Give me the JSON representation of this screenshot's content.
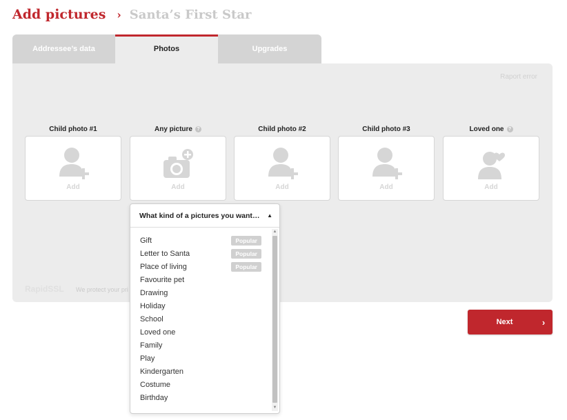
{
  "header": {
    "title": "Add pictures",
    "separator": "›",
    "breadcrumb": "Santa’s First Star"
  },
  "tabs": [
    {
      "label": "Addressee’s data"
    },
    {
      "label": "Photos"
    },
    {
      "label": "Upgrades"
    }
  ],
  "panel": {
    "report_error": "Raport error",
    "rapidssl": "RapidSSL",
    "protect_text": "We protect your pri"
  },
  "slots": [
    {
      "label": "Child photo #1",
      "add": "Add",
      "icon": "child-add-icon",
      "help": false
    },
    {
      "label": "Any picture",
      "add": "Add",
      "icon": "camera-add-icon",
      "help": true
    },
    {
      "label": "Child photo #2",
      "add": "Add",
      "icon": "child-add-icon",
      "help": false
    },
    {
      "label": "Child photo #3",
      "add": "Add",
      "icon": "child-add-icon",
      "help": false
    },
    {
      "label": "Loved one",
      "add": "Add",
      "icon": "loved-one-icon",
      "help": true
    }
  ],
  "help_glyph": "?",
  "dropdown": {
    "header": "What kind of a pictures you want to add?",
    "items": [
      {
        "label": "Gift",
        "badge": "Popular"
      },
      {
        "label": "Letter to Santa",
        "badge": "Popular"
      },
      {
        "label": "Place of living",
        "badge": "Popular"
      },
      {
        "label": "Favourite pet",
        "badge": ""
      },
      {
        "label": "Drawing",
        "badge": ""
      },
      {
        "label": "Holiday",
        "badge": ""
      },
      {
        "label": "School",
        "badge": ""
      },
      {
        "label": "Loved one",
        "badge": ""
      },
      {
        "label": "Family",
        "badge": ""
      },
      {
        "label": "Play",
        "badge": ""
      },
      {
        "label": "Kindergarten",
        "badge": ""
      },
      {
        "label": "Costume",
        "badge": ""
      },
      {
        "label": "Birthday",
        "badge": ""
      }
    ]
  },
  "next_button": {
    "label": "Next",
    "arrow": "›"
  },
  "colors": {
    "accent": "#c0272d",
    "panel_bg": "#ececec",
    "icon_gray": "#d6d6d6"
  }
}
